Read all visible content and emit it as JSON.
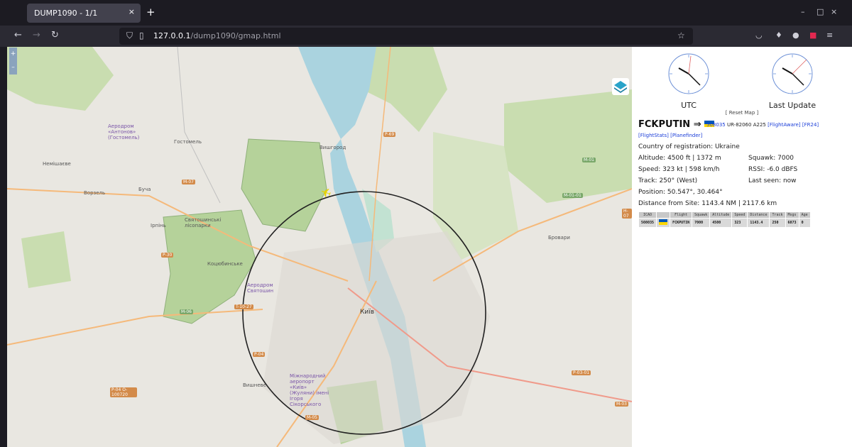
{
  "browser": {
    "tab_title": "DUMP1090 - 1/1",
    "tab_close": "×",
    "new_tab": "+",
    "url_host": "127.0.0.1",
    "url_path": "/dump1090/gmap.html",
    "window_controls": {
      "minimize": "–",
      "maximize": "□",
      "close": "×"
    }
  },
  "map": {
    "zoom_in": "+",
    "zoom_out": "–",
    "city": "Київ",
    "places": [
      "Вишгород",
      "Гостомель",
      "Ірпінь",
      "Бровари",
      "Вишневе",
      "Коцюбинське",
      "Буча",
      "Ворзель",
      "Немішаєве",
      "Святошинські лісопарки"
    ],
    "airports": [
      "Аеродром «Антонов» (Гостомель)",
      "Аеродром Святошин",
      "Міжнародний аеропорт «Київ» (Жуляни) імені Ігоря Сікорського"
    ],
    "roads": [
      "P-69",
      "M-07",
      "M-01",
      "M-01-01",
      "H-07",
      "P-30",
      "M-06",
      "T-10-27",
      "P-04",
      "M-05",
      "P-03-01",
      "M-03",
      "P-04 O-100720"
    ]
  },
  "sidebar": {
    "clock_utc_label": "UTC",
    "clock_last_label": "Last Update",
    "reset_map": "[ Reset Map ]",
    "callsign": "FCKPUTIN",
    "arrow": "⇒",
    "icao": "508035",
    "registration": "UR-82060",
    "type": "A225",
    "link_flightaware": "[FlightAware]",
    "link_fr24": "[FR24]",
    "link_flightstats": "[FlightStats]",
    "link_planefinder": "[Planefinder]",
    "country": "Country of registration: Ukraine",
    "altitude": "Altitude: 4500 ft | 1372 m",
    "squawk": "Squawk: 7000",
    "speed": "Speed: 323 kt | 598 km/h",
    "rssi": "RSSI: -6.0 dBFS",
    "track": "Track: 250° (West)",
    "last_seen": "Last seen: now",
    "position": "Position: 50.547°, 30.464°",
    "distance": "Distance from Site: 1143.4 NM | 2117.6 km",
    "table": {
      "headers": [
        "ICAO",
        "",
        "Flight",
        "Squawk",
        "Altitude",
        "Speed",
        "Distance",
        "Track",
        "Msgs",
        "Age"
      ],
      "row": [
        "508035",
        "",
        "FCKPUTIN",
        "7000",
        "4500",
        "323",
        "1143.4",
        "250",
        "6873",
        "0"
      ]
    }
  },
  "colors": {
    "ukraine_blue": "#0057b7",
    "ukraine_yellow": "#ffd700",
    "link": "#1a3dd8",
    "forest": "#b5d29a",
    "water": "#aad3df"
  }
}
